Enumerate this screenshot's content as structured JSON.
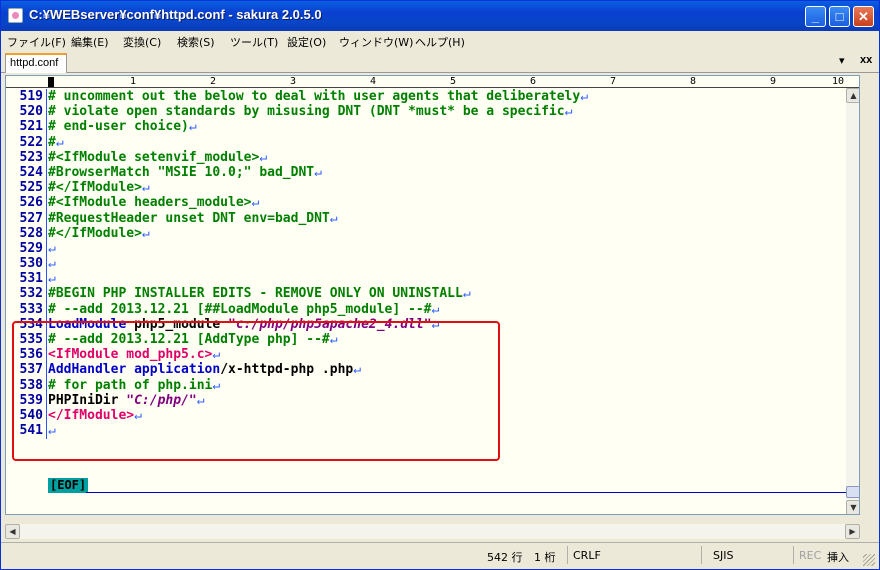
{
  "window": {
    "title": "C:¥WEBserver¥conf¥httpd.conf - sakura 2.0.5.0",
    "minimize": "_",
    "maximize": "□",
    "close": "✕"
  },
  "menu": [
    "ファイル(F)",
    "編集(E)",
    "変換(C)",
    "検索(S)",
    "ツール(T)",
    "設定(O)",
    "ウィンドウ(W)",
    "ヘルプ(H)"
  ],
  "tab": {
    "label": "httpd.conf",
    "menu_glyph": "▾",
    "close_glyph": "xx"
  },
  "ruler": {
    "marks": [
      "1",
      "2",
      "3",
      "4",
      "5",
      "6",
      "7",
      "8",
      "9",
      "10"
    ]
  },
  "lines": [
    {
      "n": "519",
      "segments": [
        {
          "t": "# uncomment out the below to deal with user agents that deliberately",
          "c": "comment"
        }
      ]
    },
    {
      "n": "520",
      "segments": [
        {
          "t": "# violate open standards by misusing DNT (DNT *must* be a specific",
          "c": "comment"
        }
      ]
    },
    {
      "n": "521",
      "segments": [
        {
          "t": "# end-user choice)",
          "c": "comment"
        }
      ]
    },
    {
      "n": "522",
      "segments": [
        {
          "t": "#",
          "c": "comment"
        }
      ]
    },
    {
      "n": "523",
      "segments": [
        {
          "t": "#<IfModule setenvif_module>",
          "c": "comment"
        }
      ]
    },
    {
      "n": "524",
      "segments": [
        {
          "t": "#BrowserMatch \"MSIE 10.0;\" bad_DNT",
          "c": "comment"
        }
      ]
    },
    {
      "n": "525",
      "segments": [
        {
          "t": "#</IfModule>",
          "c": "comment"
        }
      ]
    },
    {
      "n": "526",
      "segments": [
        {
          "t": "#<IfModule headers_module>",
          "c": "comment"
        }
      ]
    },
    {
      "n": "527",
      "segments": [
        {
          "t": "#RequestHeader unset DNT env=bad_DNT",
          "c": "comment"
        }
      ]
    },
    {
      "n": "528",
      "segments": [
        {
          "t": "#</IfModule>",
          "c": "comment"
        }
      ]
    },
    {
      "n": "529",
      "segments": []
    },
    {
      "n": "530",
      "segments": []
    },
    {
      "n": "531",
      "segments": []
    },
    {
      "n": "532",
      "segments": [
        {
          "t": "#BEGIN PHP INSTALLER EDITS - REMOVE ONLY ON UNINSTALL",
          "c": "comment"
        }
      ]
    },
    {
      "n": "533",
      "segments": [
        {
          "t": "# --add 2013.12.21 [##LoadModule php5_module] --#",
          "c": "comment"
        }
      ]
    },
    {
      "n": "534",
      "segments": [
        {
          "t": "LoadModule",
          "c": "key"
        },
        {
          "t": " php5_module ",
          "c": "plain"
        },
        {
          "t": "\"c:/php/php5apache2_4.dll\"",
          "c": "str"
        }
      ]
    },
    {
      "n": "535",
      "segments": [
        {
          "t": "# --add 2013.12.21 [AddType php] --#",
          "c": "comment"
        }
      ]
    },
    {
      "n": "536",
      "segments": [
        {
          "t": "<IfModule mod_php5.c>",
          "c": "tag"
        }
      ]
    },
    {
      "n": "537",
      "segments": [
        {
          "t": "AddHandler application",
          "c": "key"
        },
        {
          "t": "/x-httpd-php .php",
          "c": "plain"
        }
      ]
    },
    {
      "n": "538",
      "segments": [
        {
          "t": "# for path of php.ini",
          "c": "comment"
        }
      ]
    },
    {
      "n": "539",
      "segments": [
        {
          "t": "PHPIniDir ",
          "c": "plain"
        },
        {
          "t": "\"C:/php/\"",
          "c": "str"
        }
      ]
    },
    {
      "n": "540",
      "segments": [
        {
          "t": "</IfModule>",
          "c": "tag"
        }
      ]
    },
    {
      "n": "541",
      "segments": []
    }
  ],
  "line_end_mark": "↵",
  "eof_label": "[EOF]",
  "status": {
    "line": "542 行",
    "column": "1 桁",
    "newline": "CRLF",
    "encoding": "SJIS",
    "rec": "REC",
    "insert_mode": "挿入"
  },
  "colors": {
    "comment": "#008000",
    "keyword": "#0000c8",
    "string": "#800080",
    "tag": "#e0006a",
    "line_number": "#0000a0",
    "highlight_box": "#e01010",
    "editor_bg": "#fffff4"
  }
}
